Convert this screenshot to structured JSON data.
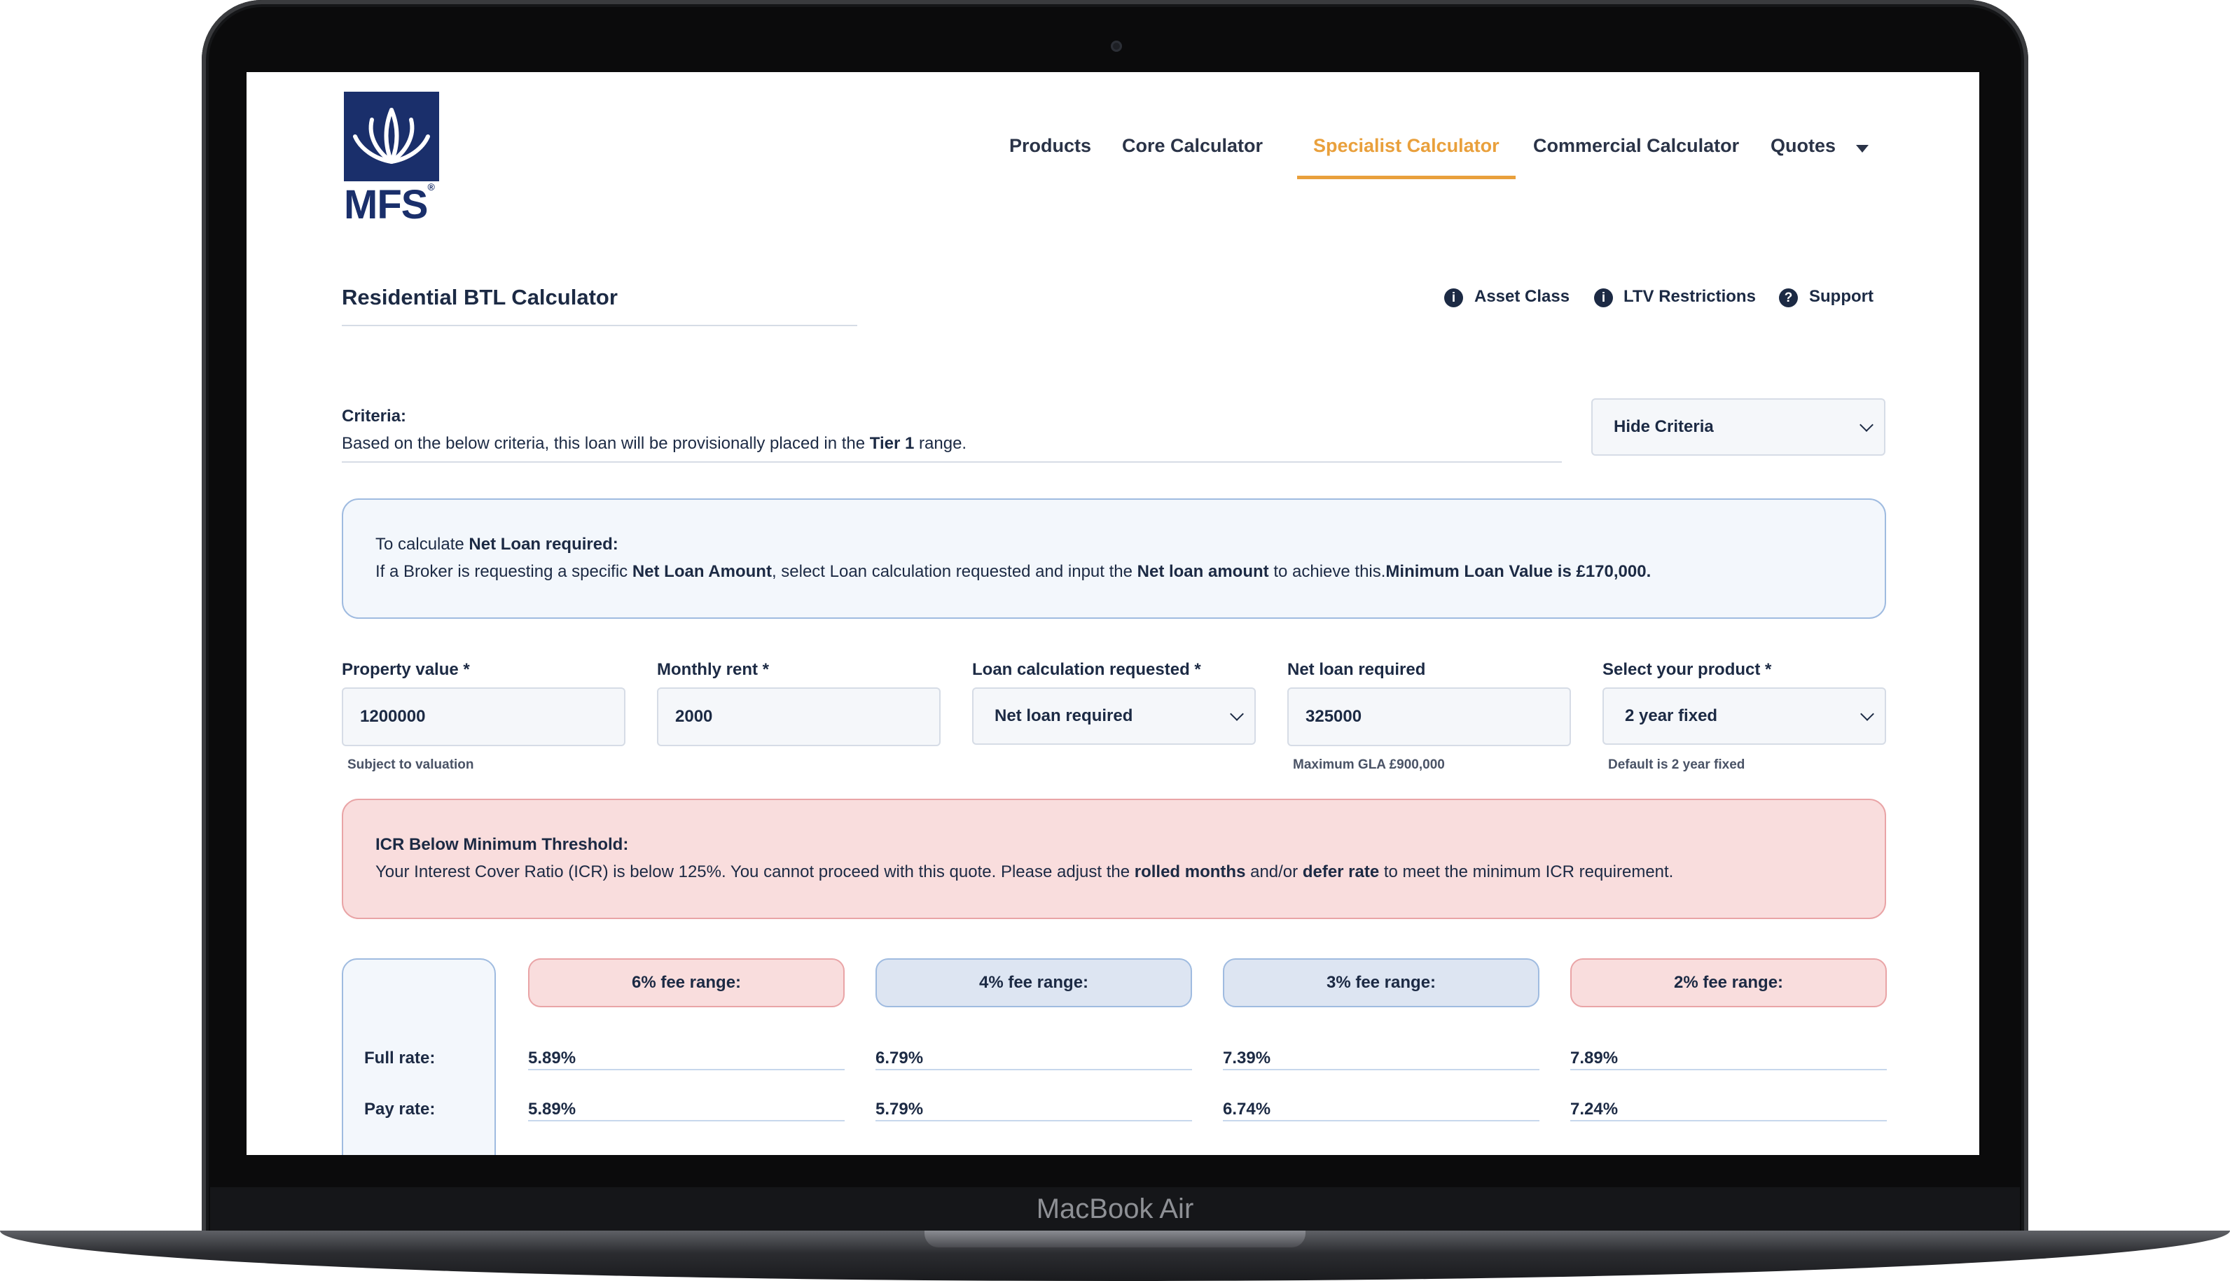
{
  "device": {
    "model_name": "MacBook Air"
  },
  "brand": {
    "logo_text": "MFS",
    "logo_mark": "®",
    "primary_color": "#1a2f6b",
    "accent_color": "#e9a03c"
  },
  "nav": {
    "items": [
      "Products",
      "Core Calculator",
      "Specialist Calculator",
      "Commercial Calculator",
      "Quotes"
    ],
    "active": "Specialist Calculator"
  },
  "page": {
    "title": "Residential BTL Calculator"
  },
  "help_links": [
    "Asset Class",
    "LTV Restrictions",
    "Support"
  ],
  "criteria": {
    "label": "Criteria:",
    "text_before": "Based on the below criteria, this loan will be provisionally placed in the ",
    "tier": "Tier 1",
    "text_after": " range.",
    "toggle_label": "Hide Criteria"
  },
  "info": {
    "line1_prefix": "To calculate ",
    "line1_bold": "Net Loan required:",
    "line2_a": "If a Broker is requesting a specific ",
    "line2_b": "Net Loan Amount",
    "line2_c": ", select Loan calculation requested and input the ",
    "line2_d": "Net loan amount",
    "line2_e": " to achieve this.",
    "line2_f": "Minimum Loan Value is £170,000."
  },
  "fields": {
    "property_value": {
      "label": "Property value *",
      "value": "1200000",
      "hint": "Subject to valuation"
    },
    "monthly_rent": {
      "label": "Monthly rent *",
      "value": "2000"
    },
    "loan_calc": {
      "label": "Loan calculation requested *",
      "value": "Net loan required"
    },
    "net_loan": {
      "label": "Net loan required",
      "value": "325000",
      "hint": "Maximum GLA £900,000"
    },
    "product": {
      "label": "Select your product *",
      "value": "2 year fixed",
      "hint": "Default is 2 year fixed"
    }
  },
  "warning": {
    "title": "ICR Below Minimum Threshold:",
    "text_a": "Your Interest Cover Ratio (ICR) is below 125%. You cannot proceed with this quote. Please adjust the ",
    "text_b": "rolled months",
    "text_c": " and/or ",
    "text_d": "defer rate",
    "text_e": " to meet the minimum ICR requirement."
  },
  "rates": {
    "row_labels": [
      "Full rate:",
      "Pay rate:"
    ],
    "ranges": [
      {
        "label": "6% fee range:",
        "full_rate": "5.89%",
        "pay_rate": "5.89%",
        "style": "red"
      },
      {
        "label": "4% fee range:",
        "full_rate": "6.79%",
        "pay_rate": "5.79%",
        "style": "blue"
      },
      {
        "label": "3% fee range:",
        "full_rate": "7.39%",
        "pay_rate": "6.74%",
        "style": "blue"
      },
      {
        "label": "2% fee range:",
        "full_rate": "7.89%",
        "pay_rate": "7.24%",
        "style": "red"
      }
    ]
  },
  "icons": {
    "info": "info-circle-icon",
    "help": "question-circle-icon",
    "dropdown": "chevron-down-icon",
    "quotes_menu": "caret-down-icon"
  }
}
